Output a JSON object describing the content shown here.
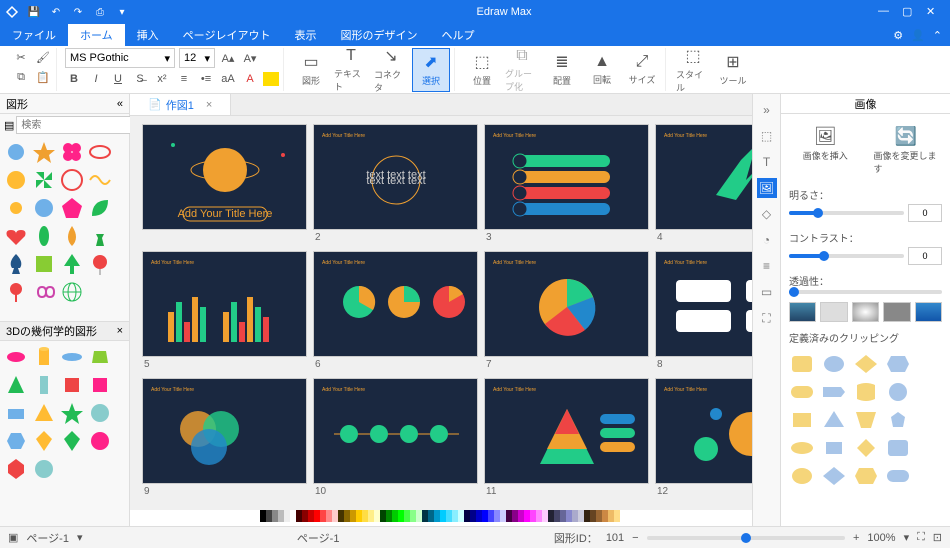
{
  "app_title": "Edraw Max",
  "menu": {
    "file": "ファイル",
    "home": "ホーム",
    "insert": "挿入",
    "page_layout": "ページレイアウト",
    "view": "表示",
    "shape_design": "図形のデザイン",
    "help": "ヘルプ"
  },
  "ribbon": {
    "font_family": "MS PGothic",
    "font_size": "12",
    "shape": "図形",
    "text": "テキスト",
    "connector": "コネクタ",
    "select": "選択",
    "position": "位置",
    "group": "グループ化",
    "align": "配置",
    "rotate": "回転",
    "size": "サイズ",
    "style": "スタイル",
    "tool": "ツール"
  },
  "left": {
    "title": "図形",
    "search_ph": "検索",
    "cat": "3Dの幾何学的図形"
  },
  "tab": {
    "name": "作図1"
  },
  "slides": [
    {
      "n": "",
      "title": "Add Your Title Here"
    },
    {
      "n": "2",
      "title": "Add Your Title Here"
    },
    {
      "n": "3",
      "title": "Add Your Title Here"
    },
    {
      "n": "4",
      "title": "Add Your Title Here"
    },
    {
      "n": "5",
      "title": "Add Your Title Here"
    },
    {
      "n": "6",
      "title": "Add Your Title Here"
    },
    {
      "n": "7",
      "title": "Add Your Title Here"
    },
    {
      "n": "8",
      "title": "Add Your Title Here"
    },
    {
      "n": "9",
      "title": "Add Your Title Here"
    },
    {
      "n": "10",
      "title": "Add Your Title Here"
    },
    {
      "n": "11",
      "title": "Add Your Title Here"
    },
    {
      "n": "12",
      "title": "Add Your Title Here"
    }
  ],
  "right": {
    "title": "画像",
    "insert_img": "画像を挿入",
    "change_img": "画像を変更します",
    "brightness": "明るさ：",
    "contrast": "コントラスト：",
    "transparency": "透過性：",
    "val0": "0",
    "clip_preset": "定義済みのクリッピング"
  },
  "status": {
    "page": "ページ-1",
    "page2": "ページ-1",
    "shape_id_lbl": "図形ID：",
    "shape_id": "101",
    "zoom": "100%"
  }
}
